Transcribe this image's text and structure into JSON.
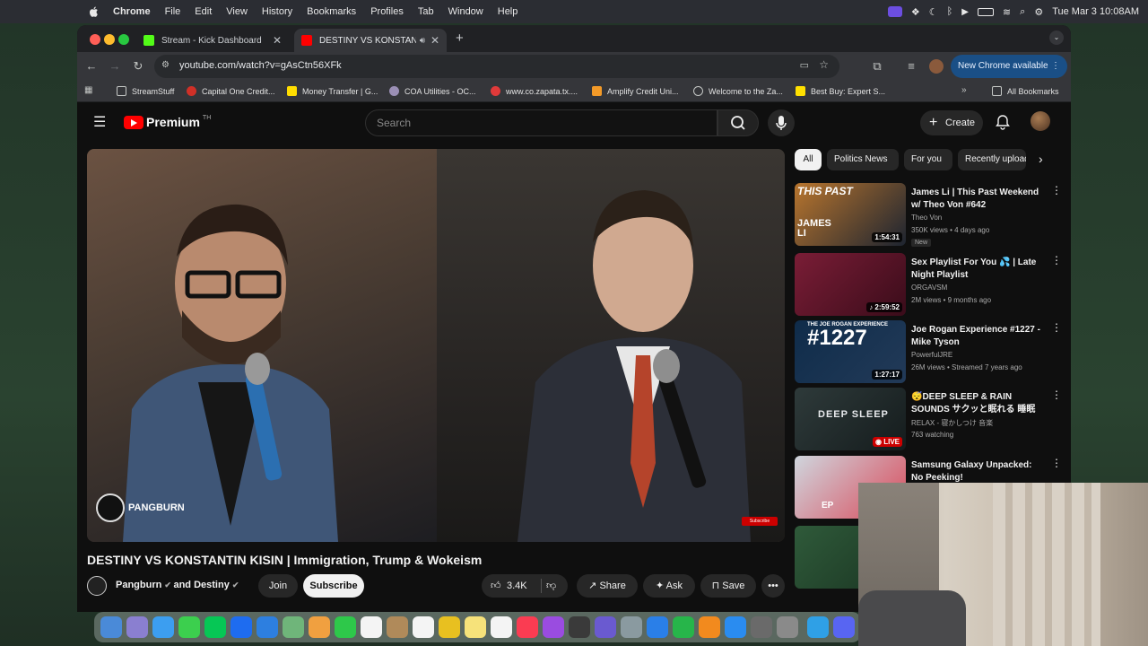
{
  "menubar": {
    "app": "Chrome",
    "items": [
      "File",
      "Edit",
      "View",
      "History",
      "Bookmarks",
      "Profiles",
      "Tab",
      "Window",
      "Help"
    ],
    "clock": "Tue Mar 3  10:08AM"
  },
  "tabs": [
    {
      "title": "Stream - Kick Dashboard",
      "active": false
    },
    {
      "title": "DESTINY VS KONSTANTIN",
      "active": true
    }
  ],
  "address": {
    "url": "youtube.com/watch?v=gAsCtn56XFk"
  },
  "new_chrome": "New Chrome available",
  "bookmarks": [
    "StreamStuff",
    "Capital One Credit...",
    "Money Transfer | G...",
    "COA Utilities - OC...",
    "www.co.zapata.tx....",
    "Amplify Credit Uni...",
    "Welcome to the Za...",
    "Best Buy: Expert S..."
  ],
  "all_bookmarks": "All Bookmarks",
  "youtube": {
    "logo": "Premium",
    "logo_sup": "TH",
    "search_placeholder": "Search",
    "create": "Create"
  },
  "video": {
    "title": "DESTINY VS KONSTANTIN KISIN | Immigration, Trump & Wokeism",
    "watermark": "PANGBURN",
    "subscribe_watermark": "Subscribe",
    "channel": "Pangburn",
    "and": "and",
    "collab": "Destiny",
    "join": "Join",
    "subscribe": "Subscribe",
    "likes": "3.4K",
    "share": "Share",
    "ask": "Ask",
    "save": "Save"
  },
  "chips": [
    "All",
    "Politics News",
    "For you",
    "Recently uploaded"
  ],
  "recommendations": [
    {
      "title": "James Li | This Past Weekend w/ Theo Von #642",
      "channel": "Theo Von",
      "meta": "350K views • 4 days ago",
      "duration": "1:54:31",
      "badge": "New",
      "thumb_text": "THIS PAST",
      "thumb_text2": "JAMES LI",
      "color1": "#b8752e",
      "color2": "#1d2430"
    },
    {
      "title": "Sex Playlist For You 💦 | Late Night Playlist",
      "channel": "ORGAVSM",
      "meta": "2M views • 9 months ago",
      "duration": "2:59:52",
      "badge": "",
      "thumb_text": "",
      "thumb_text2": "",
      "color1": "#7a1d36",
      "color2": "#3a0c1a"
    },
    {
      "title": "Joe Rogan Experience #1227 - Mike Tyson",
      "channel": "PowerfulJRE",
      "meta": "26M views • Streamed 7 years ago",
      "duration": "1:27:17",
      "badge": "",
      "thumb_text": "THE JOE ROGAN EXPERIENCE",
      "thumb_text2": "#1227",
      "color1": "#0f2c4a",
      "color2": "#223a58"
    },
    {
      "title": "😴DEEP SLEEP & RAIN SOUNDS サクッと眠れる 睡眠用BGM...",
      "channel": "RELAX - 寝かしつけ 音楽",
      "meta": "763 watching",
      "duration": "LIVE",
      "badge": "",
      "thumb_text": "",
      "thumb_text2": "DEEP SLEEP",
      "color1": "#2e3a3a",
      "color2": "#151c1d"
    },
    {
      "title": "Samsung Galaxy Unpacked: No Peeking!",
      "channel": "",
      "meta": "",
      "duration": "",
      "badge": "",
      "thumb_text": "",
      "thumb_text2": "EP",
      "color1": "#cfd6de",
      "color2": "#d94a5a"
    }
  ]
}
